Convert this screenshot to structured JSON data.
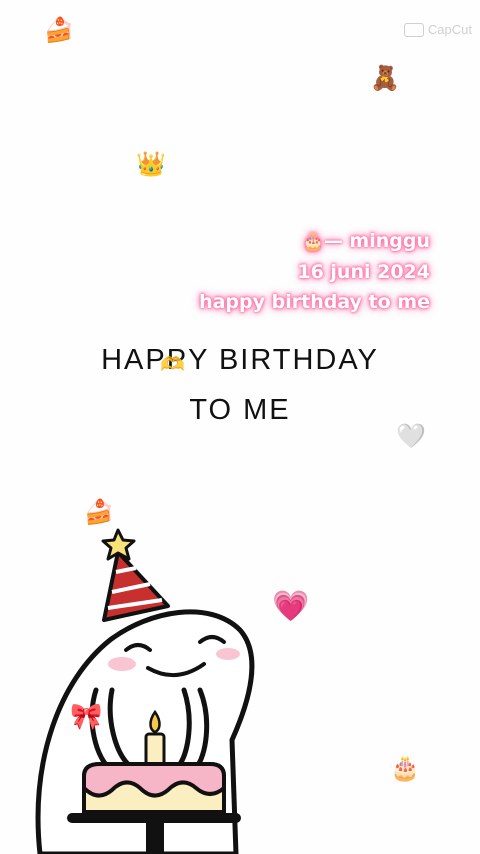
{
  "watermark": {
    "label": "CapCut",
    "icon": "capcut-logo-icon"
  },
  "decorations": {
    "cake_slice_top": "🍰",
    "teddy_bear": "🧸",
    "crown": "👑",
    "white_heart": "🤍",
    "cake_slice_left": "🍰",
    "growing_heart": "💗",
    "bow": "🎀",
    "birthday_cake": "🎂",
    "heart_hands": "🫶"
  },
  "caption": {
    "line1_emoji": "🎂",
    "line1_text": "— minggu",
    "line2": "16 juni 2024",
    "line3": "happy birthday to me"
  },
  "title": {
    "line1": "HAPPY BIRTHDAY",
    "line2": "TO ME"
  },
  "colors": {
    "glow_pink": "#ff6fa3",
    "hat_red": "#c8302f",
    "cake_pink": "#f7b6c8",
    "cake_cream": "#fbeec0",
    "star_yellow": "#f8e27a"
  }
}
